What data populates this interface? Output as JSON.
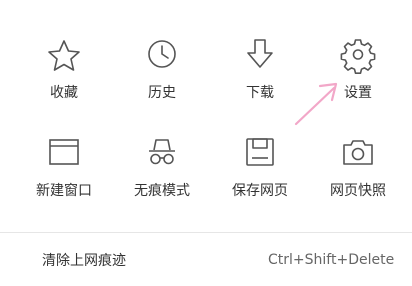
{
  "menu": {
    "row1": [
      {
        "label": "收藏",
        "icon": "star-icon"
      },
      {
        "label": "历史",
        "icon": "clock-icon"
      },
      {
        "label": "下载",
        "icon": "download-icon"
      },
      {
        "label": "设置",
        "icon": "gear-icon"
      }
    ],
    "row2": [
      {
        "label": "新建窗口",
        "icon": "window-icon"
      },
      {
        "label": "无痕模式",
        "icon": "incognito-icon"
      },
      {
        "label": "保存网页",
        "icon": "save-icon"
      },
      {
        "label": "网页快照",
        "icon": "camera-icon"
      }
    ],
    "clear_traces": {
      "label": "清除上网痕迹",
      "shortcut": "Ctrl+Shift+Delete"
    }
  },
  "colors": {
    "icon_stroke": "#555555",
    "text": "#333333",
    "annotation_arrow": "#f2a7c8"
  }
}
